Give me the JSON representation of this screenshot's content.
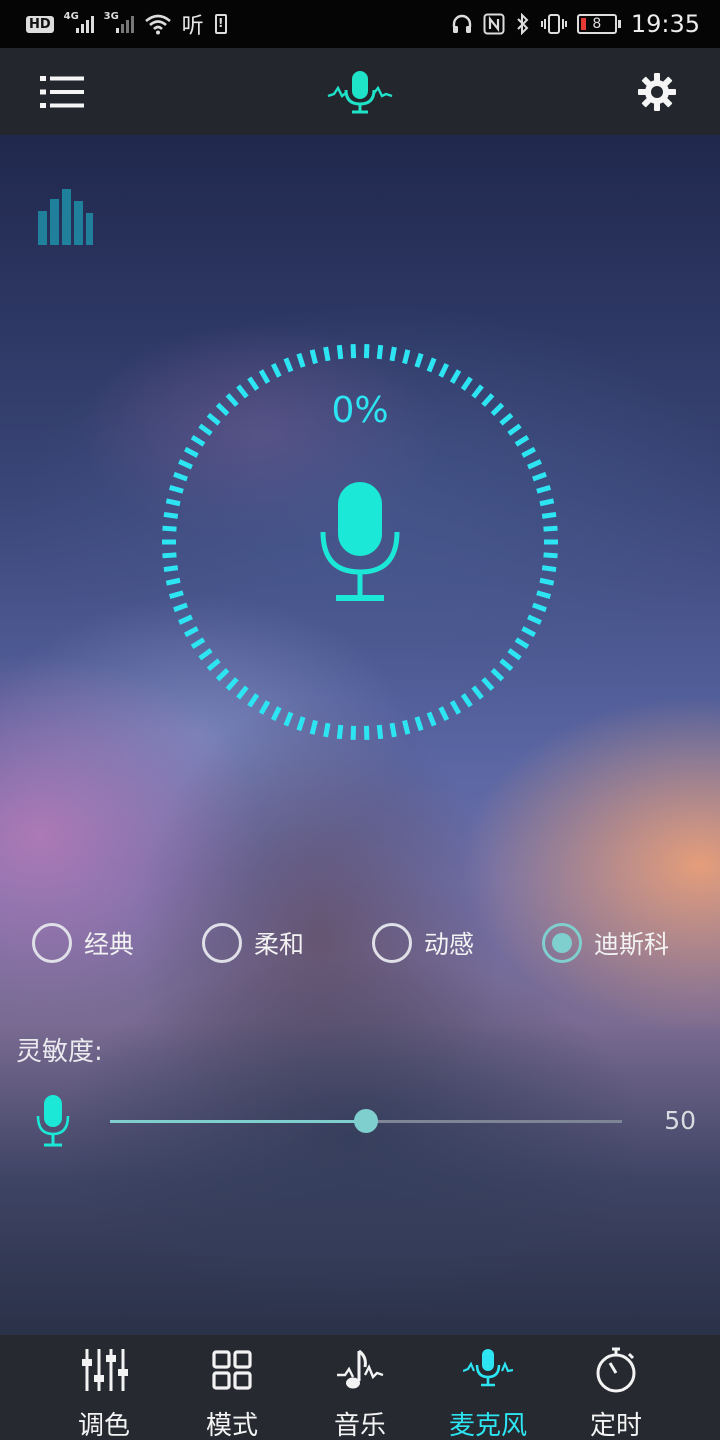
{
  "status_bar": {
    "hd": "HD",
    "net1": "4G",
    "net2": "3G",
    "listen": "听",
    "battery": "8",
    "time": "19:35"
  },
  "header": {
    "menu_icon": "list-icon",
    "logo_icon": "mic-wave-icon",
    "settings_icon": "gear-icon"
  },
  "main": {
    "percent": "0%",
    "sensitivity_label": "灵敏度:",
    "sensitivity_value": "50",
    "sensitivity_fraction": 0.5
  },
  "modes": [
    {
      "label": "经典",
      "selected": false
    },
    {
      "label": "柔和",
      "selected": false
    },
    {
      "label": "动感",
      "selected": false
    },
    {
      "label": "迪斯科",
      "selected": true
    }
  ],
  "bottom_nav": [
    {
      "label": "调色",
      "icon": "sliders-icon",
      "active": false
    },
    {
      "label": "模式",
      "icon": "grid-icon",
      "active": false
    },
    {
      "label": "音乐",
      "icon": "music-note-icon",
      "active": false
    },
    {
      "label": "麦克风",
      "icon": "mic-wave-icon",
      "active": true
    },
    {
      "label": "定时",
      "icon": "stopwatch-icon",
      "active": false
    }
  ],
  "colors": {
    "accent": "#2de5f2",
    "accent_soft": "#7fcfcf",
    "bar_bg": "#23262d",
    "nav_bg": "#262930"
  }
}
